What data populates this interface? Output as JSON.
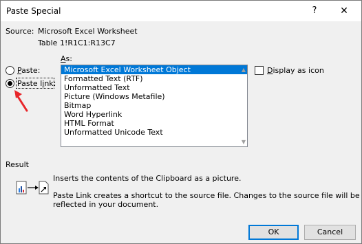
{
  "window": {
    "title": "Paste Special",
    "help_label": "?",
    "close_label": "✕"
  },
  "source": {
    "label": "Source:",
    "value": "Microsoft Excel Worksheet",
    "range": "Table 1!R1C1:R13C7"
  },
  "as_label": "As:",
  "options": {
    "paste_label": "Paste:",
    "paste_link_label": "Paste link:",
    "selected": "paste_link"
  },
  "formats": [
    "Microsoft Excel Worksheet Object",
    "Formatted Text (RTF)",
    "Unformatted Text",
    "Picture (Windows Metafile)",
    "Bitmap",
    "Word Hyperlink",
    "HTML Format",
    "Unformatted Unicode Text"
  ],
  "selected_format": "Microsoft Excel Worksheet Object",
  "display_as_icon": {
    "label": "Display as icon",
    "checked": false
  },
  "result": {
    "label": "Result",
    "line1": "Inserts the contents of the Clipboard as a picture.",
    "line2": "Paste Link creates a shortcut to the source file. Changes to the source file will be",
    "line3": "reflected in your document."
  },
  "buttons": {
    "ok": "OK",
    "cancel": "Cancel"
  },
  "colors": {
    "selection": "#0078d7",
    "annotation_arrow": "#e8262a"
  }
}
